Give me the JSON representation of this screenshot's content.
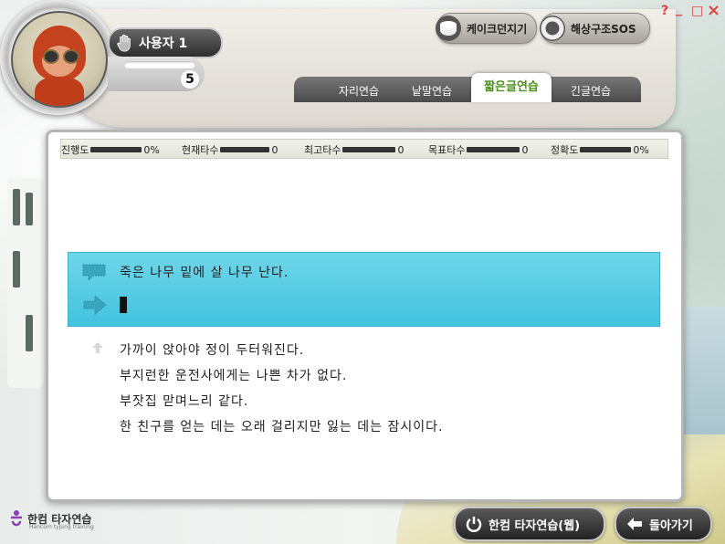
{
  "user": {
    "name": "사용자 1",
    "level": "5"
  },
  "games": {
    "cake": "케이크던지기",
    "sos": "해상구조SOS"
  },
  "window_controls": {
    "help": "?",
    "minimize": "_",
    "maximize": "□",
    "close": "×"
  },
  "tabs": [
    {
      "label": "자리연습",
      "active": false
    },
    {
      "label": "낱말연습",
      "active": false
    },
    {
      "label": "짧은글연습",
      "active": true
    },
    {
      "label": "긴글연습",
      "active": false
    }
  ],
  "stats": {
    "progress": {
      "label": "진행도",
      "value": "0%"
    },
    "current_speed": {
      "label": "현재타수",
      "value": "0"
    },
    "max_speed": {
      "label": "최고타수",
      "value": "0"
    },
    "target_speed": {
      "label": "목표타수",
      "value": "0"
    },
    "accuracy": {
      "label": "정확도",
      "value": "0%"
    }
  },
  "practice": {
    "current_sentence": "죽은 나무 밑에 살 나무 난다.",
    "input_text": "",
    "upcoming": [
      "가까이 앉아야 정이 두터워진다.",
      "부지런한 운전사에게는 나쁜 차가 없다.",
      "부잣집 맏며느리 같다.",
      "한 친구를 얻는 데는 오래 걸리지만 잃는 데는 잠시이다."
    ]
  },
  "logo": {
    "name": "한컴 타자연습",
    "tagline": "Hancom typing training"
  },
  "buttons": {
    "web": "한컴 타자연습(웹)",
    "back": "돌아가기"
  },
  "colors": {
    "accent_tab": "#4c8f1a",
    "typing_box": "#43c3de"
  }
}
